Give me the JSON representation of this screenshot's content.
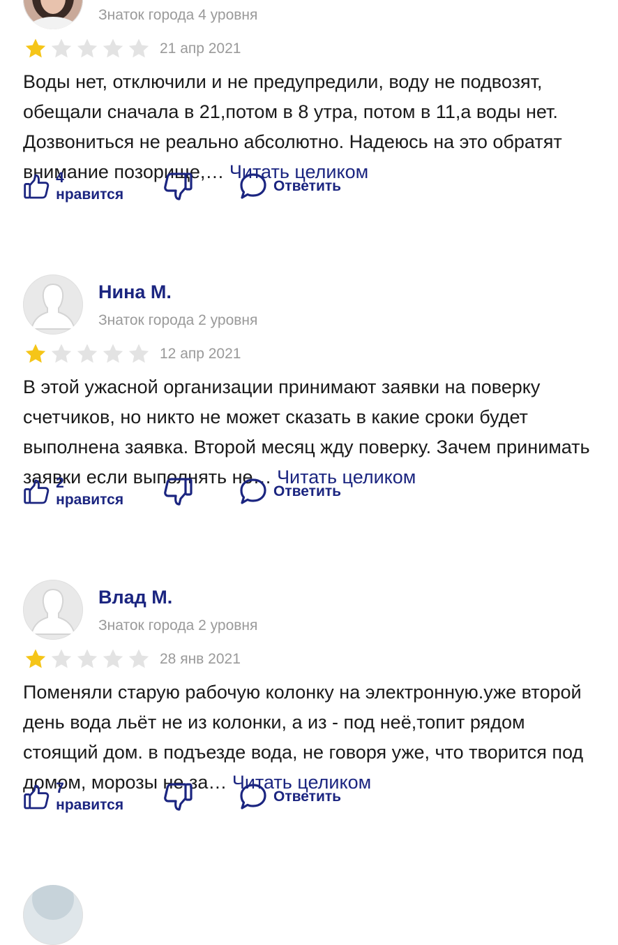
{
  "colors": {
    "accent": "#1b2580",
    "muted": "#9a9a9a",
    "star_on": "#f5c518",
    "star_off": "#e3e3e3"
  },
  "reviews": [
    {
      "author": "",
      "level": "Знаток города 4 уровня",
      "rating": 1,
      "rating_max": 5,
      "date": "21 апр 2021",
      "text": "Воды нет, отключили и не предупредили, воду не подвозят, обещали сначала в 21,потом в 8 утра, потом в 11,а воды нет. Дозвониться не реально абсолютно. Надеюсь на это обратят внимание позорище,… ",
      "read_more": "Читать целиком",
      "likes": "4 нравится",
      "reply": "Ответить"
    },
    {
      "author": "Нина М.",
      "level": "Знаток города 2 уровня",
      "rating": 1,
      "rating_max": 5,
      "date": "12 апр 2021",
      "text": "В этой ужасной организации принимают заявки на поверку счетчиков, но никто не может сказать в какие сроки будет выполнена заявка. Второй месяц жду поверку. Зачем принимать заявки если выполнять не… ",
      "read_more": "Читать целиком",
      "likes": "2 нравится",
      "reply": "Ответить"
    },
    {
      "author": "Влад М.",
      "level": "Знаток города 2 уровня",
      "rating": 1,
      "rating_max": 5,
      "date": "28 янв 2021",
      "text": "Поменяли старую рабочую колонку на электронную.уже второй день вода льёт не из колонки, а из - под неё,топит рядом стоящий дом. в подъезде вода, не говоря уже, что творится под домом, морозы не за… ",
      "read_more": "Читать целиком",
      "likes": "7 нравится",
      "reply": "Ответить"
    }
  ]
}
